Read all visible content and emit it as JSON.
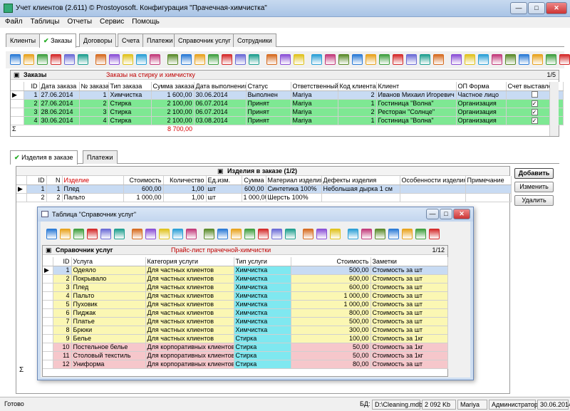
{
  "window": {
    "title": "Учет клиентов (2.611) © Prostoyosoft. Конфигурация \"Прачечная-химчистка\"",
    "min": "—",
    "max": "□",
    "close": "✕"
  },
  "menu": [
    "Файл",
    "Таблицы",
    "Отчеты",
    "Сервис",
    "Помощь"
  ],
  "tabs": [
    "Клиенты",
    "Заказы",
    "Договоры",
    "Счета",
    "Платежи",
    "Справочник услуг",
    "Сотрудники"
  ],
  "orders": {
    "title": "Заказы",
    "subtitle": "Заказы на стирку и химчистку",
    "count": "1/5",
    "columns": [
      "ID",
      "Дата заказа",
      "№ заказа",
      "Тип заказа",
      "Сумма заказа",
      "Дата выполнения",
      "Статус",
      "Ответственный",
      "Код клиента",
      "Клиент",
      "ОП Форма",
      "Счет выставлен"
    ],
    "rows": [
      [
        "1",
        "27.06.2014",
        "1",
        "Химчистка",
        "1 600,00",
        "30.06.2014",
        "Выполнен",
        "Mariya",
        "2",
        "Иванов Михаил Игоревич",
        "Частное лицо",
        ""
      ],
      [
        "2",
        "27.06.2014",
        "2",
        "Стирка",
        "2 100,00",
        "06.07.2014",
        "Принят",
        "Mariya",
        "1",
        "Гостиница \"Волна\"",
        "Организация",
        "✓"
      ],
      [
        "3",
        "28.06.2014",
        "3",
        "Стирка",
        "2 100,00",
        "06.07.2014",
        "Принят",
        "Mariya",
        "2",
        "Ресторан \"Солнце\"",
        "Организация",
        "✓"
      ],
      [
        "4",
        "30.06.2014",
        "4",
        "Стирка",
        "2 100,00",
        "03.08.2014",
        "Принят",
        "Mariya",
        "1",
        "Гостиница \"Волна\"",
        "Организация",
        "✓"
      ]
    ],
    "sum_symbol": "Σ",
    "total": "8 700,00"
  },
  "subtabs": [
    "Изделия в заказе",
    "Платежи"
  ],
  "items": {
    "title": "Изделия в заказе (1/2)",
    "columns": [
      "ID",
      "N",
      "Изделие",
      "Стоимость",
      "Количество",
      "Ед.изм.",
      "Сумма",
      "Материал изделия",
      "Дефекты изделия",
      "Особенности изделия",
      "Примечание"
    ],
    "rows": [
      [
        "1",
        "1",
        "Плед",
        "600,00",
        "1,00",
        "шт",
        "600,00",
        "Синтетика 100%",
        "Небольшая дырка 1 см",
        "",
        ""
      ],
      [
        "2",
        "2",
        "Пальто",
        "1 000,00",
        "1,00",
        "шт",
        "1 000,00",
        "Шерсть 100%",
        "",
        "",
        ""
      ]
    ],
    "buttons": [
      "Добавить",
      "Изменить",
      "Удалить"
    ]
  },
  "dialog": {
    "title": "Таблица \"Справочник услуг\"",
    "header": "Справочник услуг",
    "subtitle": "Прайс-лист прачечной-химчистки",
    "count": "1/12",
    "columns": [
      "ID",
      "Услуга",
      "Категория услуги",
      "Тип услуги",
      "Стоимость",
      "Заметки"
    ],
    "rows": [
      [
        "1",
        "Одеяло",
        "Для частных клиентов",
        "Химчистка",
        "500,00",
        "Стоимость за шт"
      ],
      [
        "2",
        "Покрывало",
        "Для частных клиентов",
        "Химчистка",
        "600,00",
        "Стоимость за шт"
      ],
      [
        "3",
        "Плед",
        "Для частных клиентов",
        "Химчистка",
        "600,00",
        "Стоимость за шт"
      ],
      [
        "4",
        "Пальто",
        "Для частных клиентов",
        "Химчистка",
        "1 000,00",
        "Стоимость за шт"
      ],
      [
        "5",
        "Пуховик",
        "Для частных клиентов",
        "Химчистка",
        "1 000,00",
        "Стоимость за шт"
      ],
      [
        "6",
        "Пиджак",
        "Для частных клиентов",
        "Химчистка",
        "800,00",
        "Стоимость за шт"
      ],
      [
        "7",
        "Платье",
        "Для частных клиентов",
        "Химчистка",
        "500,00",
        "Стоимость за шт"
      ],
      [
        "8",
        "Брюки",
        "Для частных клиентов",
        "Химчистка",
        "300,00",
        "Стоимость за шт"
      ],
      [
        "9",
        "Белье",
        "Для частных клиентов",
        "Стирка",
        "100,00",
        "Стоимость за 1кг"
      ],
      [
        "10",
        "Постельное белье",
        "Для корпоративных клиентов",
        "Стирка",
        "50,00",
        "Стоимость за 1кг"
      ],
      [
        "11",
        "Столовый текстиль",
        "Для корпоративных клиентов",
        "Стирка",
        "50,00",
        "Стоимость за 1кг"
      ],
      [
        "12",
        "Униформа",
        "Для корпоративных клиентов",
        "Стирка",
        "80,00",
        "Стоимость за шт"
      ]
    ]
  },
  "status": {
    "left": "Готово",
    "db_label": "БД:",
    "db_path": "D:\\Cleaning.mdb",
    "size": "2 092 Kb",
    "user": "Mariya",
    "role": "Администратор",
    "date": "30.06.2014"
  },
  "colors": {
    "green_row": "#7ee893",
    "yellow_row": "#fbf7b3",
    "pink_row": "#f6c7cb",
    "cyan_cell": "#7fe8f0",
    "accent_red": "#d40000"
  }
}
